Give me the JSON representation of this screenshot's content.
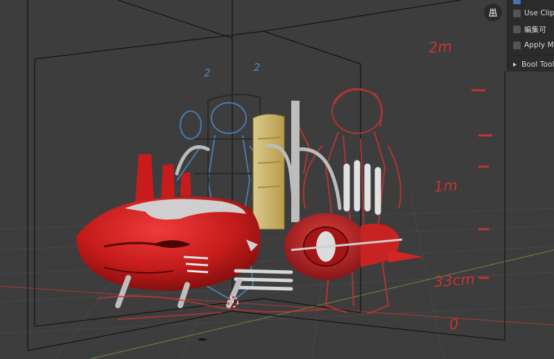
{
  "panel": {
    "use_clip_label": "Use Clip",
    "edit_label": "編集可",
    "apply_label": "Apply Mir",
    "bool_tool_label": "Bool Tool",
    "partial_top_checked": true
  },
  "scale_annotations": {
    "two_m": "2m",
    "one_m": "1m",
    "thirty_three_cm": "33cm",
    "zero": "0"
  },
  "sketch_marks": [
    "2",
    "2"
  ],
  "colors": {
    "viewport_bg": "#3d3d3d",
    "panel_bg": "#2b2b2b",
    "red_body": "#c81c1c",
    "red_sketch": "#c63333",
    "blue_sketch": "#4b86c0",
    "checkbox_active": "#4772b3"
  },
  "icons": {
    "gizmo": "grid-floor-icon",
    "expand": "triangle-right-icon"
  }
}
